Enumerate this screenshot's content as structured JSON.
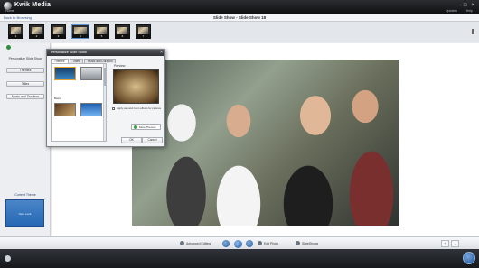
{
  "app": {
    "title": "Kwik Media",
    "home": "Home",
    "updates": "Updates",
    "help": "Help"
  },
  "header": {
    "back": "Back to Browsing",
    "title": "Slide Show - Slide Show 18"
  },
  "filmstrip": {
    "items": [
      "1",
      "2",
      "3",
      "4",
      "5",
      "6",
      "7"
    ]
  },
  "left_panel": {
    "title": "Personalize Slide Show",
    "buttons": [
      "Themes",
      "Titles",
      "Music and Duration"
    ],
    "current_theme_label": "Current Theme",
    "current_theme_name": "Nero Look"
  },
  "dialog": {
    "title": "Personalize Slide Show",
    "tabs": [
      "Themes",
      "Titles",
      "Music and Duration"
    ],
    "section_basic": "Basic",
    "preview_label": "Preview",
    "option_text": "Apply pan and zoom effects for pictures",
    "more_themes": "More Themes",
    "ok": "OK",
    "cancel": "Cancel"
  },
  "toolbar": {
    "advanced_editing": "Advanced Editing",
    "edit_photo": "Edit Photo",
    "slideshow_more": "SlideShows",
    "zoom_left": "+",
    "zoom_right": "-"
  }
}
